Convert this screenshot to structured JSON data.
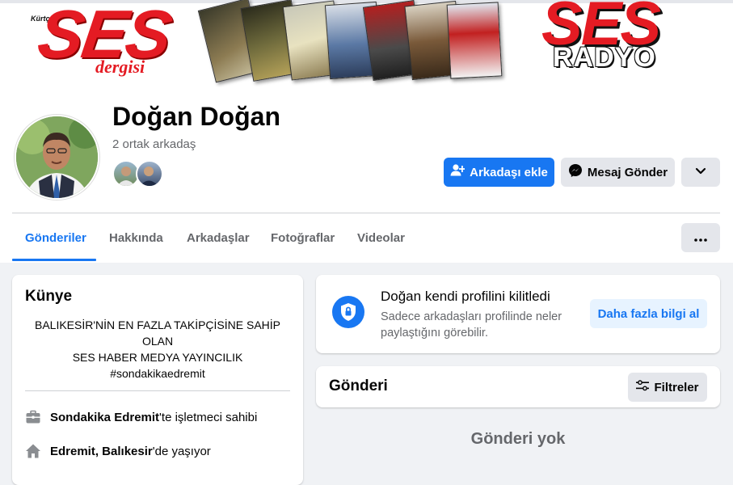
{
  "cover": {
    "left_logo_text": "SES",
    "left_logo_sub": "dergisi",
    "left_logo_small": "Kürtçe",
    "right_logo_text": "SES",
    "right_logo_sub": "RADYO"
  },
  "profile": {
    "name": "Doğan Doğan",
    "mutual_friends": "2 ortak arkadaş"
  },
  "actions": {
    "add_friend": "Arkadaşı ekle",
    "send_message": "Mesaj Gönder"
  },
  "tabs": [
    {
      "label": "Gönderiler",
      "active": true
    },
    {
      "label": "Hakkında",
      "active": false
    },
    {
      "label": "Arkadaşlar",
      "active": false
    },
    {
      "label": "Fotoğraflar",
      "active": false
    },
    {
      "label": "Videolar",
      "active": false
    }
  ],
  "intro": {
    "title": "Künye",
    "bio_lines": [
      "BALIKESİR'NİN EN FAZLA TAKİPÇİSİNE SAHİP",
      "OLAN",
      "SES HABER MEDYA YAYINCILIK",
      "#sondakikaedremit"
    ],
    "work_bold": "Sondakika Edremit",
    "work_rest": "'te işletmeci sahibi",
    "home_bold": "Edremit, Balıkesir",
    "home_rest": "'de yaşıyor"
  },
  "locked": {
    "title": "Doğan kendi profilini kilitledi",
    "subtitle": "Sadece arkadaşları profilinde neler paylaştığını görebilir.",
    "learn_more": "Daha fazla bilgi al"
  },
  "posts": {
    "title": "Gönderi",
    "filters": "Filtreler",
    "empty": "Gönderi yok"
  },
  "colors": {
    "accent": "#1877f2",
    "brand_red": "#e41b23",
    "secondary_bg": "#e4e6eb",
    "page_bg": "#f0f2f5",
    "muted_text": "#65676b"
  },
  "icons": [
    "add-friend-icon",
    "messenger-icon",
    "chevron-down-icon",
    "more-dots-icon",
    "shield-lock-icon",
    "filter-icon",
    "briefcase-icon",
    "home-icon"
  ]
}
